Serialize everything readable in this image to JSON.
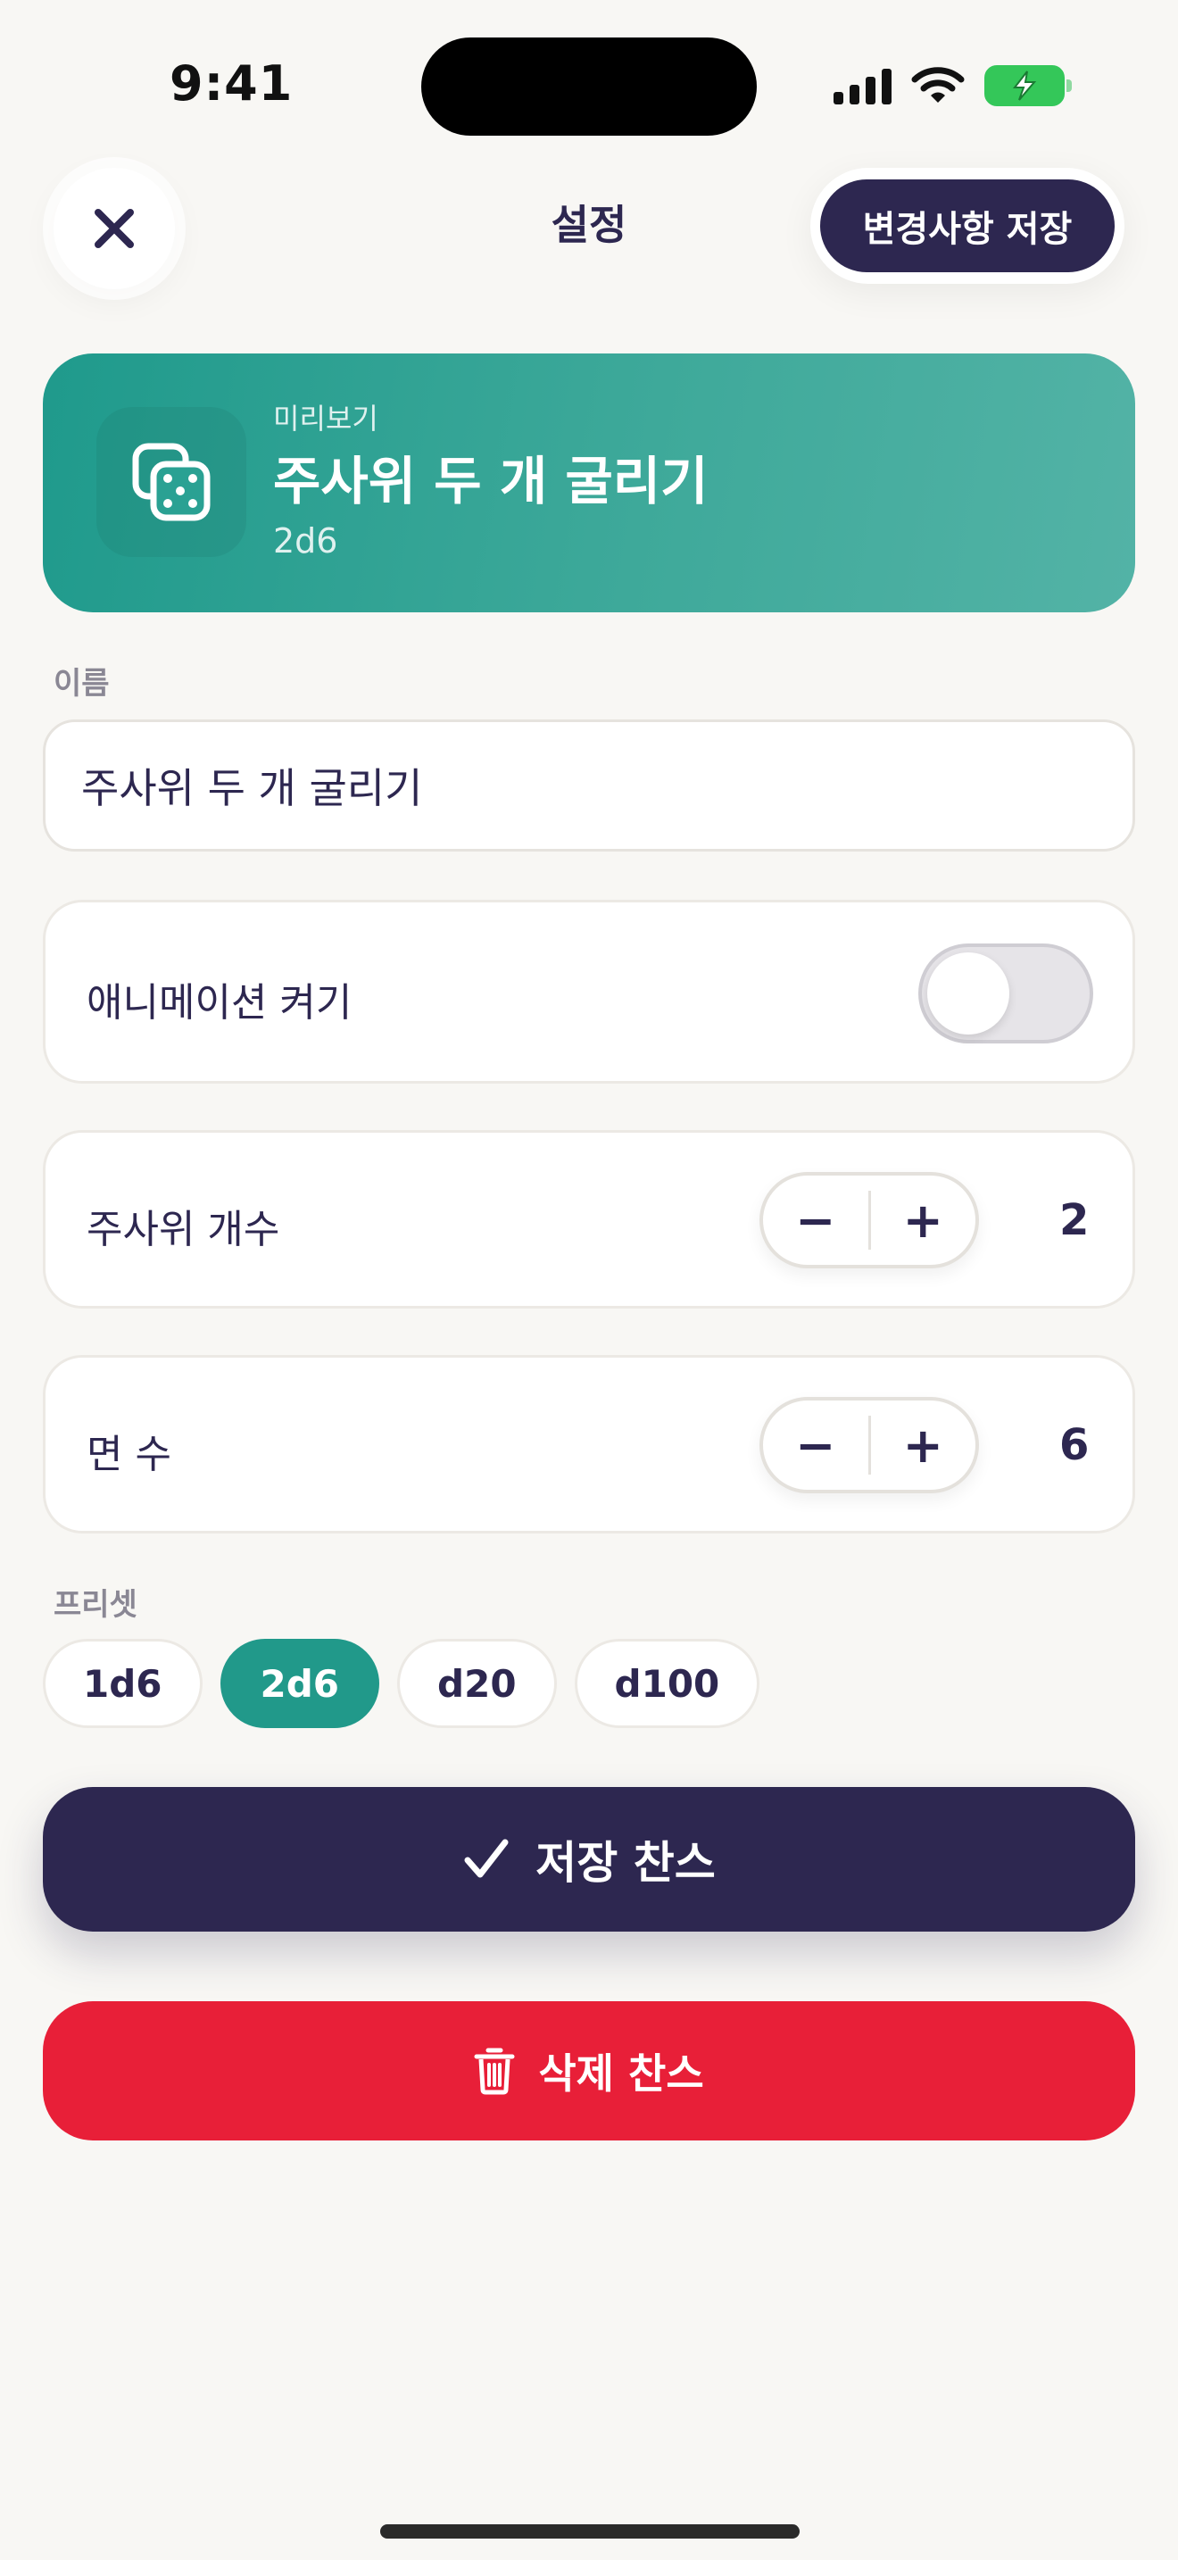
{
  "status_bar": {
    "time": "9:41"
  },
  "header": {
    "title": "설정",
    "save_changes_label": "변경사항 저장"
  },
  "preview": {
    "eyebrow": "미리보기",
    "title": "주사위 두 개 굴리기",
    "notation": "2d6",
    "icon": "dice-icon"
  },
  "name_field": {
    "label": "이름",
    "value": "주사위 두 개 굴리기"
  },
  "animation": {
    "label": "애니메이션 켜기",
    "enabled": false
  },
  "dice_count": {
    "label": "주사위 개수",
    "decrement": "−",
    "increment": "+",
    "value": "2"
  },
  "faces": {
    "label": "면 수",
    "decrement": "−",
    "increment": "+",
    "value": "6"
  },
  "presets": {
    "label": "프리셋",
    "items": [
      "1d6",
      "2d6",
      "d20",
      "d100"
    ],
    "selected": "2d6"
  },
  "actions": {
    "save_label": "저장 찬스",
    "delete_label": "삭제 찬스"
  },
  "colors": {
    "primary": "#2d2750",
    "accent_teal": "#21998a",
    "danger": "#e81f38",
    "background": "#f8f7f4"
  }
}
